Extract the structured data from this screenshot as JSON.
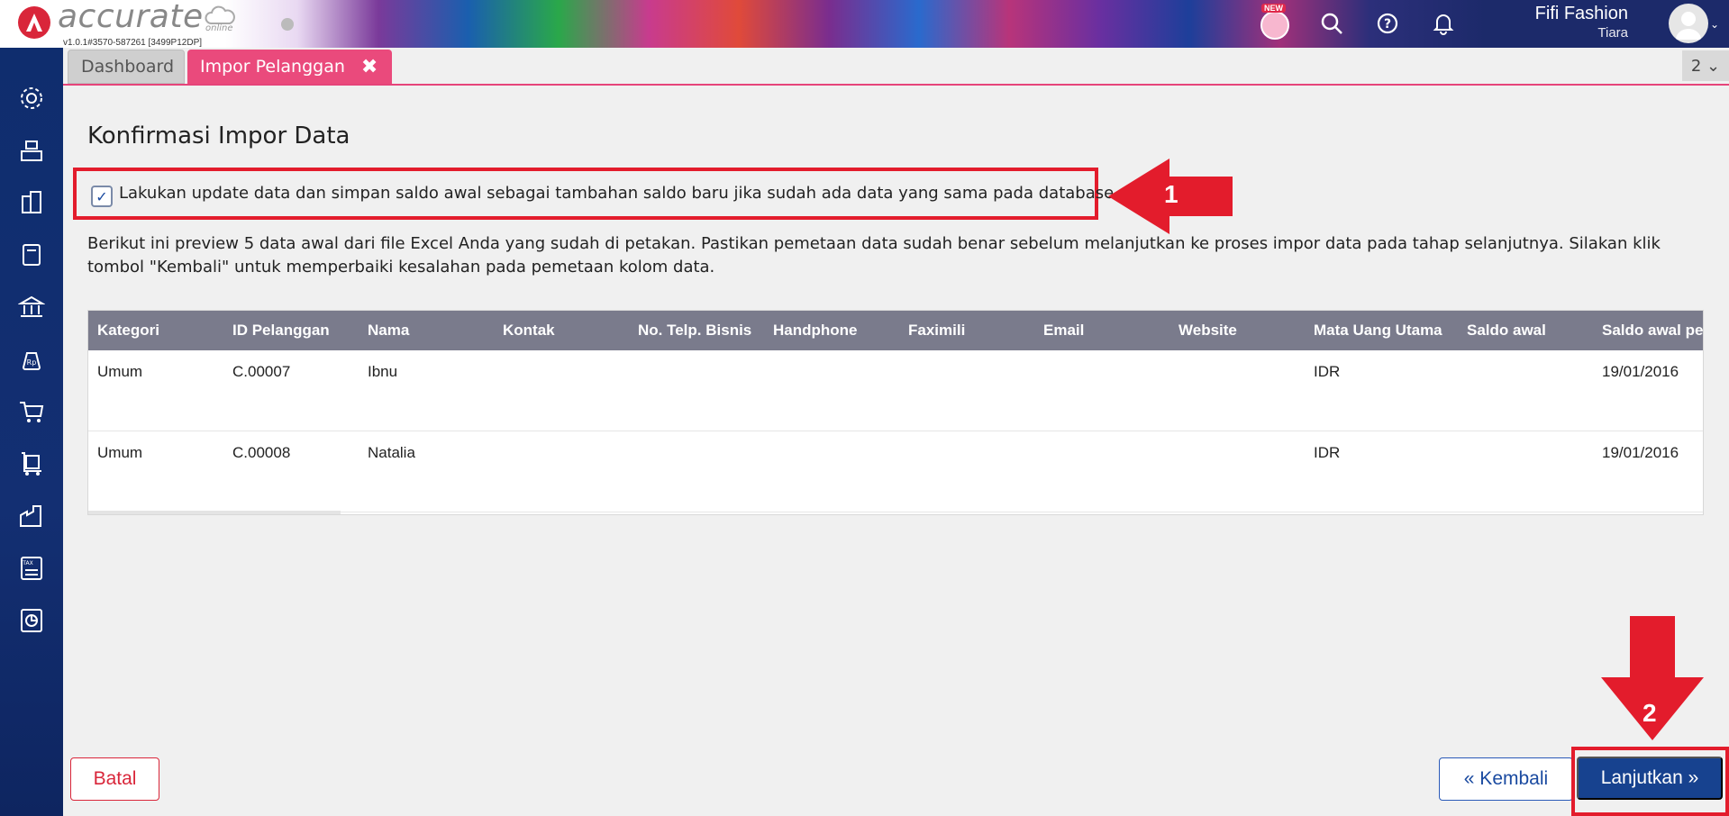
{
  "header": {
    "brand": "accurate",
    "brand_sub": "online",
    "version": "v1.0.1#3570-587261 [3499P12DP]",
    "new_badge": "NEW",
    "company": "Fifi Fashion",
    "user": "Tiara"
  },
  "sidebar": {
    "icons": [
      "gear-icon",
      "cash-register-icon",
      "building-icon",
      "ledger-icon",
      "bank-icon",
      "money-bag-icon",
      "cart-icon",
      "trolley-icon",
      "factory-icon",
      "tax-icon",
      "report-icon"
    ]
  },
  "tabs": {
    "items": [
      {
        "label": "Dashboard"
      },
      {
        "label": "Impor Pelanggan"
      }
    ],
    "close_glyph": "✖",
    "count": "2 ⌄"
  },
  "main": {
    "title": "Konfirmasi Impor Data",
    "option_label": "Lakukan update data dan simpan saldo awal sebagai tambahan saldo baru jika sudah ada data yang sama pada database",
    "option_checked": true,
    "annotation_1": "1",
    "annotation_2": "2",
    "description": "Berikut ini preview 5 data awal dari file Excel Anda yang sudah di petakan. Pastikan pemetaan data sudah benar sebelum melanjutkan ke proses impor data pada tahap selanjutnya. Silakan klik tombol \"Kembali\" untuk memperbaiki kesalahan pada pemetaan kolom data."
  },
  "table": {
    "columns": [
      "Kategori",
      "ID Pelanggan",
      "Nama",
      "Kontak",
      "No. Telp. Bisnis",
      "Handphone",
      "Faximili",
      "Email",
      "Website",
      "Mata Uang Utama",
      "Saldo awal",
      "Saldo awal pe"
    ],
    "rows": [
      [
        "Umum",
        "C.00007",
        "Ibnu",
        "",
        "",
        "",
        "",
        "",
        "",
        "IDR",
        "",
        "19/01/2016"
      ],
      [
        "Umum",
        "C.00008",
        "Natalia",
        "",
        "",
        "",
        "",
        "",
        "",
        "IDR",
        "",
        "19/01/2016"
      ]
    ]
  },
  "buttons": {
    "cancel": "Batal",
    "back": "« Kembali",
    "next": "Lanjutkan »"
  },
  "colors": {
    "accent_tab": "#ea4a7c",
    "sidebar": "#0f2d6e",
    "primary_button": "#17428f",
    "annotation_red": "#e31c2c"
  }
}
